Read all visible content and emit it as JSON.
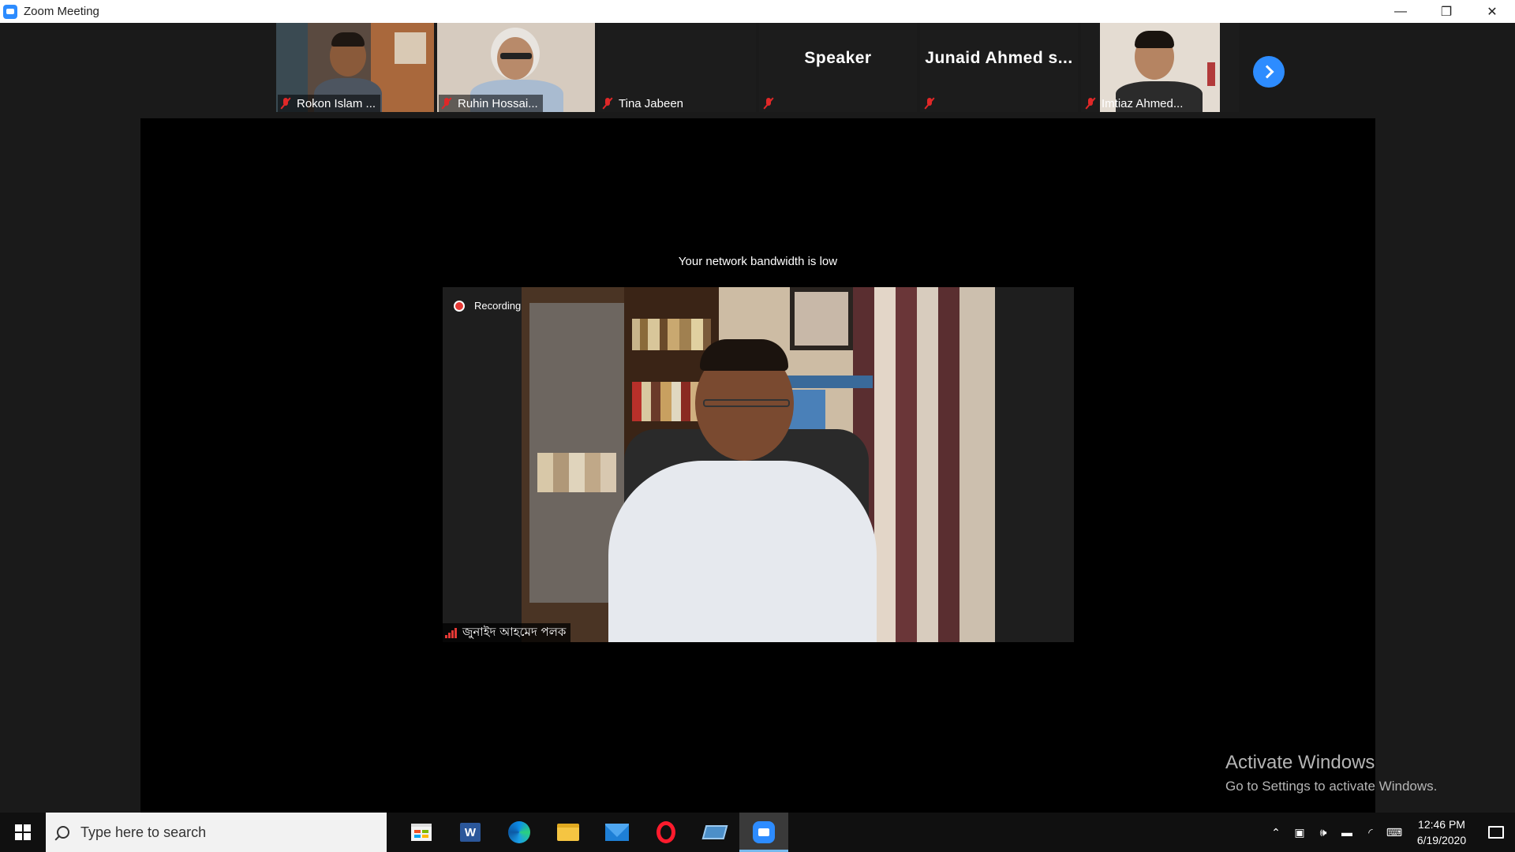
{
  "window": {
    "title": "Zoom Meeting",
    "minimize": "—",
    "restore": "❐",
    "close": "✕"
  },
  "participants": [
    {
      "name": "Rokon Islam ...",
      "video": true,
      "muted": true
    },
    {
      "name": "Ruhin Hossai...",
      "video": true,
      "muted": true
    },
    {
      "name": "Tina Jabeen",
      "video": false,
      "muted": true
    },
    {
      "name": "",
      "display_name": "Speaker",
      "video": false,
      "muted": true
    },
    {
      "name": "",
      "display_name": "Junaid  Ahmed  s...",
      "video": false,
      "muted": true
    },
    {
      "name": "Imtiaz Ahmed...",
      "video": true,
      "muted": true
    }
  ],
  "stage": {
    "notice": "Your network bandwidth is low",
    "recording_label": "Recording",
    "speaker_name": "জুনাইদ আহমেদ পলক"
  },
  "watermark": {
    "line1": "Activate Windows",
    "line2": "Go to Settings to activate Windows."
  },
  "taskbar": {
    "search_placeholder": "Type here to search",
    "apps": [
      "microsoft-store-icon",
      "word-icon",
      "edge-icon",
      "file-explorer-icon",
      "mail-icon",
      "opera-icon",
      "app-icon",
      "zoom-icon"
    ],
    "time": "12:46 PM",
    "date": "6/19/2020"
  },
  "colors": {
    "zoom_blue": "#2d8cff",
    "mute_red": "#e02828",
    "recording_red": "#e53935"
  }
}
